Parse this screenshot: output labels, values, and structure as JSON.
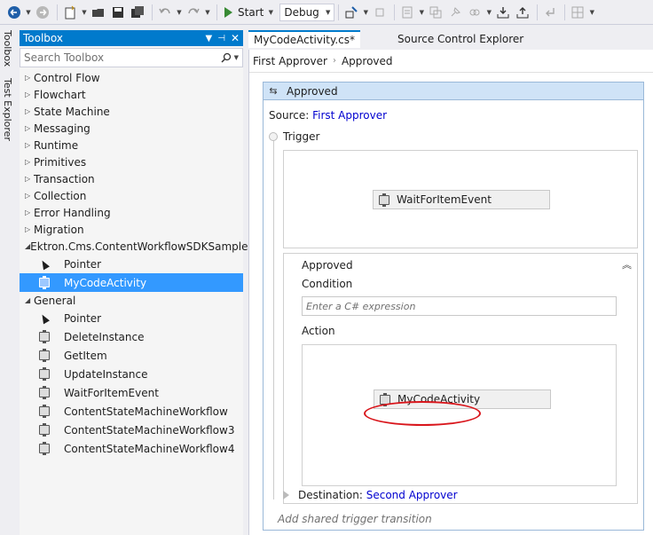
{
  "toolbar": {
    "start_label": "Start",
    "config_value": "Debug"
  },
  "side_tabs": {
    "toolbox": "Toolbox",
    "test_explorer": "Test Explorer"
  },
  "toolbox": {
    "title": "Toolbox",
    "search_placeholder": "Search Toolbox",
    "categories": [
      "Control Flow",
      "Flowchart",
      "State Machine",
      "Messaging",
      "Runtime",
      "Primitives",
      "Transaction",
      "Collection",
      "Error Handling",
      "Migration"
    ],
    "ektron_group": {
      "label": "Ektron.Cms.ContentWorkflowSDKSample",
      "items": [
        "Pointer",
        "MyCodeActivity"
      ]
    },
    "general_group": {
      "label": "General",
      "items": [
        "Pointer",
        "DeleteInstance",
        "GetItem",
        "UpdateInstance",
        "WaitForItemEvent",
        "ContentStateMachineWorkflow",
        "ContentStateMachineWorkflow3",
        "ContentStateMachineWorkflow4"
      ]
    }
  },
  "tabs": {
    "active": "MyCodeActivity.cs*",
    "inactive": "Source Control Explorer"
  },
  "breadcrumb": {
    "first": "First Approver",
    "second": "Approved"
  },
  "state": {
    "title": "Approved",
    "source_prefix": "Source:",
    "source_value": "First Approver",
    "trigger_label": "Trigger",
    "trigger_activity": "WaitForItemEvent",
    "transition_name": "Approved",
    "condition_label": "Condition",
    "condition_placeholder": "Enter a C# expression",
    "action_label": "Action",
    "action_activity": "MyCodeActivity",
    "destination_prefix": "Destination:",
    "destination_value": "Second Approver",
    "add_trigger": "Add shared trigger transition"
  },
  "colors": {
    "accent": "#007acc",
    "selection": "#3399ff",
    "highlight": "#d9161c",
    "link": "#0000d0"
  }
}
